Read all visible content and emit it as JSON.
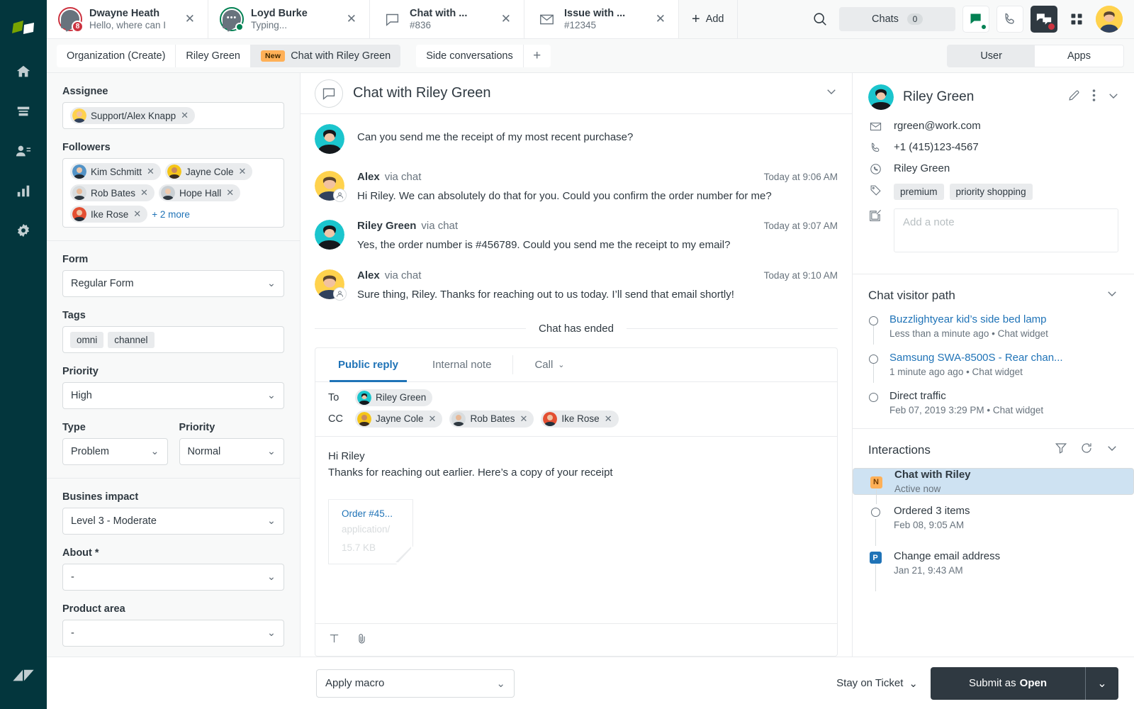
{
  "rail": {
    "logo": "zendesk-logo",
    "items": [
      {
        "name": "home-icon",
        "label": "Home"
      },
      {
        "name": "views-icon",
        "label": "Views"
      },
      {
        "name": "customers-icon",
        "label": "Customers"
      },
      {
        "name": "reporting-icon",
        "label": "Reporting"
      },
      {
        "name": "settings-icon",
        "label": "Settings"
      }
    ],
    "bottom": {
      "name": "zendesk-mark",
      "label": "Zendesk"
    }
  },
  "topbar": {
    "tabs": [
      {
        "title": "Dwayne Heath",
        "sub": "Hello, where can I",
        "badge": "8",
        "type": "chat-unread"
      },
      {
        "title": "Loyd Burke",
        "sub": "Typing...",
        "badge": "",
        "type": "chat-typing"
      },
      {
        "title": "Chat with ...",
        "sub": "#836",
        "badge": "",
        "type": "chat-icon"
      },
      {
        "title": "Issue with ...",
        "sub": "#12345",
        "badge": "",
        "type": "mail-icon"
      }
    ],
    "add_label": "Add",
    "chats_label": "Chats",
    "chats_count": "0"
  },
  "subbar": {
    "crumbs": [
      {
        "label": "Organization (Create)",
        "active": false,
        "badge": ""
      },
      {
        "label": "Riley Green",
        "active": false,
        "badge": ""
      },
      {
        "label": "Chat with Riley Green",
        "active": true,
        "badge": "New"
      }
    ],
    "side_conversations": "Side conversations",
    "segments": [
      {
        "label": "User",
        "on": true
      },
      {
        "label": "Apps",
        "on": false
      }
    ]
  },
  "form": {
    "assignee_label": "Assignee",
    "assignee": "Support/Alex Knapp",
    "followers_label": "Followers",
    "followers": [
      "Kim Schmitt",
      "Jayne Cole",
      "Rob Bates",
      "Hope Hall",
      "Ike Rose"
    ],
    "followers_more": "+ 2 more",
    "form_label": "Form",
    "form_value": "Regular Form",
    "tags_label": "Tags",
    "tags": [
      "omni",
      "channel"
    ],
    "priority_label": "Priority",
    "priority_value": "High",
    "type_label": "Type",
    "type_value": "Problem",
    "priority2_label": "Priority",
    "priority2_value": "Normal",
    "business_impact_label": "Busines impact",
    "business_impact_value": "Level 3 - Moderate",
    "about_label": "About *",
    "about_value": "-",
    "product_area_label": "Product area",
    "product_area_value": "-"
  },
  "conversation": {
    "title": "Chat with Riley Green",
    "messages": [
      {
        "author": "",
        "via": "",
        "time": "",
        "text": "Can you send me the receipt of my most recent purchase?",
        "avatar": "riley"
      },
      {
        "author": "Alex",
        "via": "via chat",
        "time": "Today at 9:06 AM",
        "text": "Hi Riley. We can absolutely do that for you. Could you confirm the order number for me?",
        "avatar": "alex"
      },
      {
        "author": "Riley Green",
        "via": "via chat",
        "time": "Today at 9:07 AM",
        "text": "Yes, the order number is #456789. Could you send me the receipt to my email?",
        "avatar": "riley"
      },
      {
        "author": "Alex",
        "via": "via chat",
        "time": "Today at 9:10 AM",
        "text": "Sure thing, Riley. Thanks for reaching out to us today. I’ll send that email shortly!",
        "avatar": "alex"
      }
    ],
    "ended_label": "Chat has ended"
  },
  "composer": {
    "tabs": [
      {
        "label": "Public reply",
        "on": true,
        "chev": false
      },
      {
        "label": "Internal note",
        "on": false,
        "chev": false
      },
      {
        "label": "Call",
        "on": false,
        "chev": true
      }
    ],
    "to_label": "To",
    "to": [
      "Riley Green"
    ],
    "cc_label": "CC",
    "cc": [
      "Jayne Cole",
      "Rob Bates",
      "Ike Rose"
    ],
    "line1": "Hi Riley",
    "line2": "Thanks for reaching out earlier. Here’s a copy of your receipt",
    "attachment": {
      "name": "Order #45...",
      "type": "application/",
      "size": "15.7 KB"
    },
    "tools": [
      "text-format-icon",
      "attachment-icon"
    ]
  },
  "user_panel": {
    "name": "Riley Green",
    "email": "rgreen@work.com",
    "phone": "+1 (415)123-4567",
    "whatsapp": "Riley Green",
    "tags": [
      "premium",
      "priority shopping"
    ],
    "note_placeholder": "Add a note",
    "visitor_path": {
      "title": "Chat visitor path",
      "items": [
        {
          "title": "Buzzlightyear kid’s side bed lamp",
          "meta": "Less than a minute ago • Chat widget",
          "link": true
        },
        {
          "title": "Samsung SWA-8500S - Rear chan...",
          "meta": "1 minute ago ago • Chat widget",
          "link": true
        },
        {
          "title": "Direct traffic",
          "meta": "Feb 07, 2019 3:29 PM • Chat widget",
          "link": false
        }
      ]
    },
    "interactions": {
      "title": "Interactions",
      "items": [
        {
          "title": "Chat with Riley",
          "meta": "Active now",
          "marker": "N",
          "selected": true
        },
        {
          "title": "Ordered 3 items",
          "meta": "Feb 08, 9:05 AM",
          "marker": "",
          "selected": false
        },
        {
          "title": "Change email address",
          "meta": "Jan 21, 9:43 AM",
          "marker": "P",
          "selected": false
        }
      ]
    }
  },
  "footer": {
    "macro": "Apply macro",
    "stay": "Stay on Ticket",
    "submit_prefix": "Submit as ",
    "submit_state": "Open"
  },
  "colors": {
    "rail_bg": "#03363D",
    "accent_blue": "#1f73b7",
    "badge_red": "#cc3340",
    "online_green": "#038153",
    "new_orange": "#FFB057",
    "dark_button": "#2f3941",
    "selected_row": "#cee2f2"
  }
}
